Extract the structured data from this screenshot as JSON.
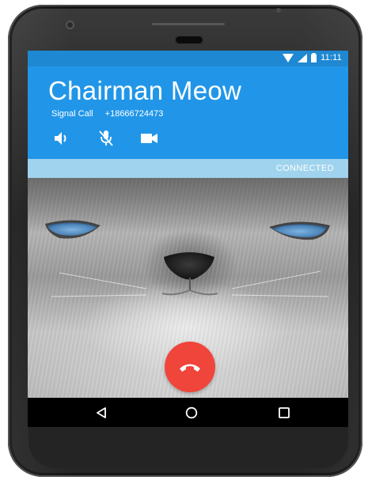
{
  "status_bar": {
    "time": "11:11",
    "icons": [
      "wifi-icon",
      "signal-icon",
      "battery-icon"
    ],
    "color": "#1e88d2"
  },
  "call": {
    "contact_name": "Chairman Meow",
    "call_type": "Signal Call",
    "phone_number": "+18666724473",
    "actions": [
      "speaker-icon",
      "mute-mic-icon",
      "video-icon"
    ],
    "header_color": "#2196e8",
    "status": "CONNECTED",
    "status_color": "#9fd3ee"
  },
  "end_call": {
    "icon": "hangup-icon",
    "color": "#f0453a"
  },
  "navigation": {
    "buttons": [
      "back-icon",
      "home-icon",
      "recents-icon"
    ]
  }
}
